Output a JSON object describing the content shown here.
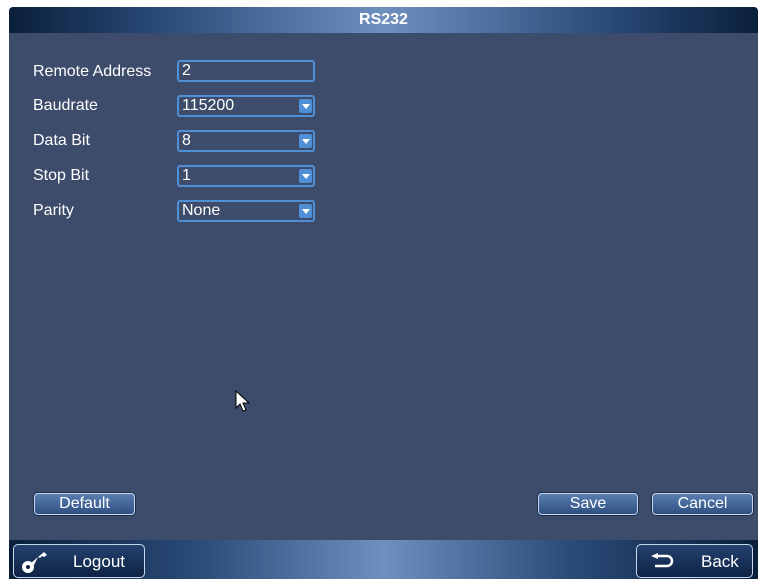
{
  "window": {
    "title": "RS232"
  },
  "form": {
    "remote_address": {
      "label": "Remote Address",
      "value": "2"
    },
    "baudrate": {
      "label": "Baudrate",
      "value": "115200"
    },
    "data_bit": {
      "label": "Data Bit",
      "value": "8"
    },
    "stop_bit": {
      "label": "Stop Bit",
      "value": "1"
    },
    "parity": {
      "label": "Parity",
      "value": "None"
    }
  },
  "buttons": {
    "default": "Default",
    "save": "Save",
    "cancel": "Cancel"
  },
  "navbar": {
    "logout": "Logout",
    "back": "Back"
  },
  "colors": {
    "panel": "#3d4c6b",
    "accent": "#4f8fd6"
  },
  "icons": {
    "dropdown": "chevron-down-icon",
    "logout": "key-icon",
    "back": "back-arrow-icon",
    "cursor": "mouse-pointer-icon"
  }
}
